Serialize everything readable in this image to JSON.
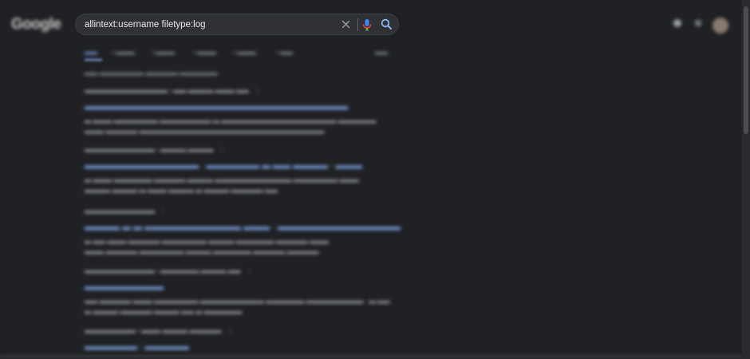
{
  "search": {
    "query": "allintext:username filetype:log"
  },
  "icons": {
    "clear": "close-icon",
    "mic": "microphone-icon",
    "search": "magnifier-icon",
    "apps": "apps-grid-icon",
    "settings": "gear-icon"
  },
  "colors": {
    "background": "#202124",
    "searchbox": "#303134",
    "link": "#8ab4f8",
    "text": "#e8eaed",
    "mic_blue": "#4285f4",
    "mic_red": "#ea4335",
    "mic_yellow": "#fbbc04",
    "mic_green": "#34a853"
  }
}
